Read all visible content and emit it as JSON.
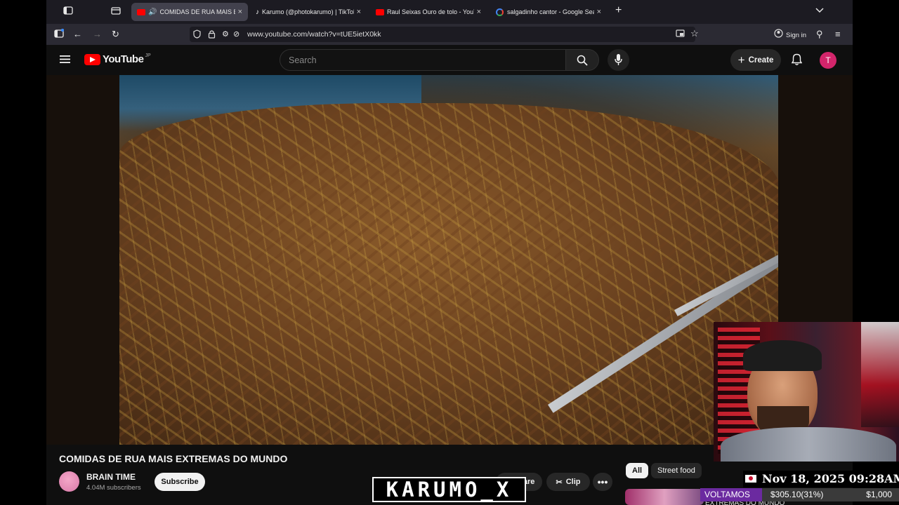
{
  "browser": {
    "tabs": [
      {
        "title": "COMIDAS DE RUA MAIS EXTREMAS DO MUNDO",
        "favicon": "youtube-favicon",
        "active": true,
        "audio": true
      },
      {
        "title": "Karumo (@photokarumo) | TikTok",
        "favicon": "tiktok-favicon",
        "active": false
      },
      {
        "title": "Raul Seixas Ouro de tolo - YouTube",
        "favicon": "youtube-favicon",
        "active": false
      },
      {
        "title": "salgadinho cantor - Google Search",
        "favicon": "google-favicon",
        "active": false
      }
    ],
    "url": "www.youtube.com/watch?v=tUE5ietX0kk",
    "sign_in": "Sign in"
  },
  "youtube": {
    "logo_text": "YouTube",
    "logo_region": "JP",
    "search_placeholder": "Search",
    "create_label": "Create",
    "avatar_letter": "T",
    "accent": "#ff0000"
  },
  "video": {
    "title": "COMIDAS DE RUA MAIS EXTREMAS DO MUNDO",
    "channel": "BRAIN TIME",
    "subscribers": "4.04M subscribers",
    "subscribe_label": "Subscribe",
    "share_label": "Share",
    "clip_label": "Clip"
  },
  "chips": [
    "All",
    "Street food"
  ],
  "overlay": {
    "date": "Nov 18, 2025 09:28AM",
    "goal_label": "VOLTAMOS",
    "goal_value": "$305.10(31%)",
    "goal_target": "$1,000",
    "goal_progress": 0.31,
    "banner": "KARUMO_X",
    "thumb_caption": "EXTREMAS DO MUNDO"
  }
}
